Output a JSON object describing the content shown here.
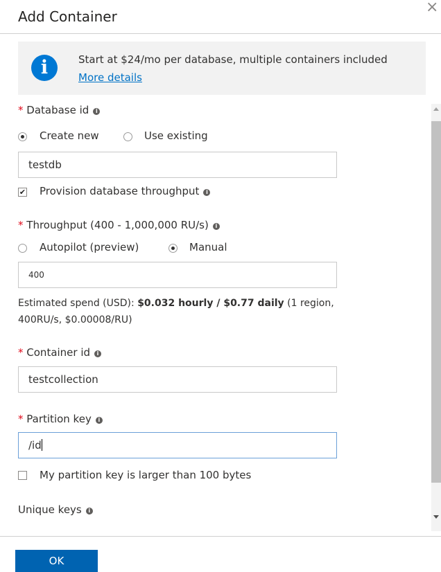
{
  "dialog": {
    "title": "Add Container",
    "close_glyph": "×"
  },
  "info": {
    "icon_letter": "i",
    "text": "Start at $24/mo per database, multiple containers included",
    "link": "More details"
  },
  "database": {
    "required_mark": "*",
    "label": "Database id",
    "tip": "i",
    "radio_create": "Create new",
    "radio_existing": "Use existing",
    "selected": "create",
    "value": "testdb",
    "provision_label": "Provision database throughput",
    "provision_checked": true,
    "provision_check_glyph": "✔"
  },
  "throughput": {
    "required_mark": "*",
    "label": "Throughput (400 - 1,000,000 RU/s)",
    "tip": "i",
    "radio_autopilot": "Autopilot (preview)",
    "radio_manual": "Manual",
    "selected": "manual",
    "value": "400",
    "spend_prefix": "Estimated spend (USD): ",
    "spend_bold": "$0.032 hourly / $0.77 daily",
    "spend_suffix": " (1 region,",
    "spend_line2": "400RU/s, $0.00008/RU)"
  },
  "container": {
    "required_mark": "*",
    "label": "Container id",
    "tip": "i",
    "value": "testcollection"
  },
  "partition": {
    "required_mark": "*",
    "label": "Partition key",
    "tip": "i",
    "value": "/id",
    "large_key_label": "My partition key is larger than 100 bytes",
    "large_key_checked": false
  },
  "unique_keys": {
    "label": "Unique keys",
    "tip": "i"
  },
  "footer": {
    "ok_label": "OK"
  },
  "colors": {
    "accent": "#0078d4",
    "button": "#0063b1",
    "required": "#e00b1c",
    "link": "#0072c6"
  }
}
